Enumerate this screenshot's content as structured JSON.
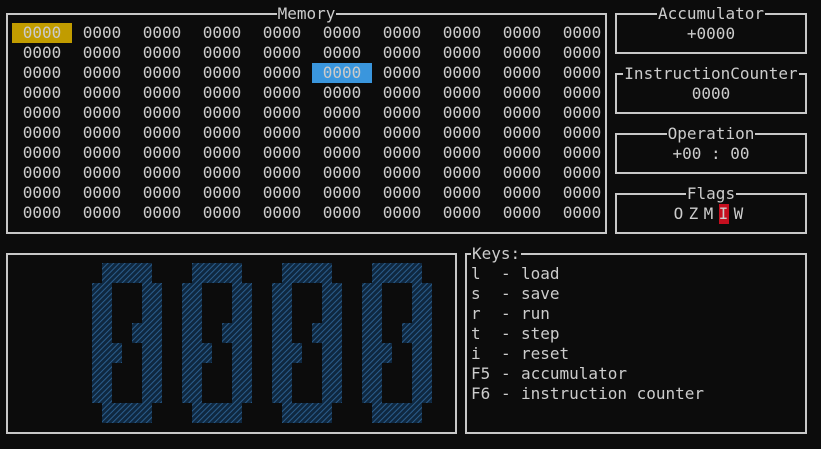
{
  "colors": {
    "background": "#0c0c0c",
    "text": "#cccccc",
    "border": "#c8c8c8",
    "current_cell": "#c19c00",
    "selected_cell": "#3a96dd",
    "flag_set": "#c50f1f",
    "big_digit": "#1f4e79"
  },
  "memory": {
    "title": "Memory",
    "current_index": 0,
    "selected_index": 25,
    "cells": [
      "0000",
      "0000",
      "0000",
      "0000",
      "0000",
      "0000",
      "0000",
      "0000",
      "0000",
      "0000",
      "0000",
      "0000",
      "0000",
      "0000",
      "0000",
      "0000",
      "0000",
      "0000",
      "0000",
      "0000",
      "0000",
      "0000",
      "0000",
      "0000",
      "0000",
      "0000",
      "0000",
      "0000",
      "0000",
      "0000",
      "0000",
      "0000",
      "0000",
      "0000",
      "0000",
      "0000",
      "0000",
      "0000",
      "0000",
      "0000",
      "0000",
      "0000",
      "0000",
      "0000",
      "0000",
      "0000",
      "0000",
      "0000",
      "0000",
      "0000",
      "0000",
      "0000",
      "0000",
      "0000",
      "0000",
      "0000",
      "0000",
      "0000",
      "0000",
      "0000",
      "0000",
      "0000",
      "0000",
      "0000",
      "0000",
      "0000",
      "0000",
      "0000",
      "0000",
      "0000",
      "0000",
      "0000",
      "0000",
      "0000",
      "0000",
      "0000",
      "0000",
      "0000",
      "0000",
      "0000",
      "0000",
      "0000",
      "0000",
      "0000",
      "0000",
      "0000",
      "0000",
      "0000",
      "0000",
      "0000",
      "0000",
      "0000",
      "0000",
      "0000",
      "0000",
      "0000",
      "0000",
      "0000",
      "0000",
      "0000"
    ]
  },
  "accumulator": {
    "title": "Accumulator",
    "value": "+0000"
  },
  "instruction_counter": {
    "title": "InstructionCounter",
    "value": "0000"
  },
  "operation": {
    "title": "Operation",
    "value": "+00 : 00"
  },
  "flags": {
    "title": "Flags",
    "items": [
      {
        "label": "O",
        "set": false
      },
      {
        "label": "Z",
        "set": false
      },
      {
        "label": "M",
        "set": false
      },
      {
        "label": "I",
        "set": true
      },
      {
        "label": "W",
        "set": false
      }
    ]
  },
  "big_display": {
    "chars": [
      {
        "glyph": "8"
      },
      {
        "glyph": "8"
      },
      {
        "glyph": "8"
      },
      {
        "glyph": "8"
      }
    ]
  },
  "keys": {
    "title": "Keys:",
    "items": [
      {
        "key": "l",
        "action": "load"
      },
      {
        "key": "s",
        "action": "save"
      },
      {
        "key": "r",
        "action": "run"
      },
      {
        "key": "t",
        "action": "step"
      },
      {
        "key": "i",
        "action": "reset"
      },
      {
        "key": "F5",
        "action": "accumulator"
      },
      {
        "key": "F6",
        "action": "instruction counter"
      }
    ],
    "separator": "-"
  }
}
